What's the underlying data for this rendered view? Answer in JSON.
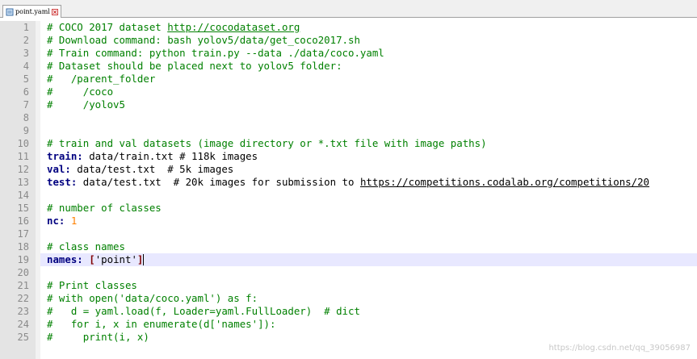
{
  "tab": {
    "label": "point.yaml"
  },
  "colors": {
    "comment": "#008000",
    "key": "#000080",
    "number": "#ff8000",
    "string": "#808080",
    "bracket": "#800000",
    "current_line": "#e8e8ff"
  },
  "lines": [
    {
      "n": "1",
      "parts": [
        {
          "t": "# COCO 2017 dataset ",
          "c": "c"
        },
        {
          "t": "http://cocodataset.org",
          "c": "c u"
        }
      ]
    },
    {
      "n": "2",
      "parts": [
        {
          "t": "# Download command: bash yolov5/data/get_coco2017.sh",
          "c": "c"
        }
      ]
    },
    {
      "n": "3",
      "parts": [
        {
          "t": "# Train command: python train.py --data ./data/coco.yaml",
          "c": "c"
        }
      ]
    },
    {
      "n": "4",
      "parts": [
        {
          "t": "# Dataset should be placed next to yolov5 folder:",
          "c": "c"
        }
      ]
    },
    {
      "n": "5",
      "parts": [
        {
          "t": "#   /parent_folder",
          "c": "c"
        }
      ]
    },
    {
      "n": "6",
      "parts": [
        {
          "t": "#     /coco",
          "c": "c"
        }
      ]
    },
    {
      "n": "7",
      "parts": [
        {
          "t": "#     /yolov5",
          "c": "c"
        }
      ]
    },
    {
      "n": "8",
      "parts": []
    },
    {
      "n": "9",
      "parts": []
    },
    {
      "n": "10",
      "parts": [
        {
          "t": "# train and val datasets (image directory or *.txt file with image paths)",
          "c": "c"
        }
      ]
    },
    {
      "n": "11",
      "parts": [
        {
          "t": "train:",
          "c": "k"
        },
        {
          "t": " data/train.txt # 118k images",
          "c": ""
        }
      ]
    },
    {
      "n": "12",
      "parts": [
        {
          "t": "val:",
          "c": "k"
        },
        {
          "t": " data/test.txt  # 5k images",
          "c": ""
        }
      ]
    },
    {
      "n": "13",
      "parts": [
        {
          "t": "test:",
          "c": "k"
        },
        {
          "t": " data/test.txt  # 20k images for submission to ",
          "c": ""
        },
        {
          "t": "https://competitions.codalab.org/competitions/20",
          "c": "u"
        }
      ]
    },
    {
      "n": "14",
      "parts": []
    },
    {
      "n": "15",
      "parts": [
        {
          "t": "# number of classes",
          "c": "c"
        }
      ]
    },
    {
      "n": "16",
      "parts": [
        {
          "t": "nc:",
          "c": "k"
        },
        {
          "t": " ",
          "c": ""
        },
        {
          "t": "1",
          "c": "num"
        }
      ]
    },
    {
      "n": "17",
      "parts": []
    },
    {
      "n": "18",
      "parts": [
        {
          "t": "# class names",
          "c": "c"
        }
      ]
    },
    {
      "n": "19",
      "current": true,
      "parts": [
        {
          "t": "names:",
          "c": "k"
        },
        {
          "t": " ",
          "c": ""
        },
        {
          "t": "[",
          "c": "br"
        },
        {
          "t": "'point'",
          "c": ""
        },
        {
          "t": "]",
          "c": "br"
        }
      ]
    },
    {
      "n": "20",
      "parts": []
    },
    {
      "n": "21",
      "parts": [
        {
          "t": "# Print classes",
          "c": "c"
        }
      ]
    },
    {
      "n": "22",
      "parts": [
        {
          "t": "# with open('data/coco.yaml') as f:",
          "c": "c"
        }
      ]
    },
    {
      "n": "23",
      "parts": [
        {
          "t": "#   d = yaml.load(f, Loader=yaml.FullLoader)  # dict",
          "c": "c"
        }
      ]
    },
    {
      "n": "24",
      "parts": [
        {
          "t": "#   for i, x in enumerate(d['names']):",
          "c": "c"
        }
      ]
    },
    {
      "n": "25",
      "parts": [
        {
          "t": "#     print(i, x)",
          "c": "c"
        }
      ]
    }
  ],
  "watermark": "https://blog.csdn.net/qq_39056987"
}
